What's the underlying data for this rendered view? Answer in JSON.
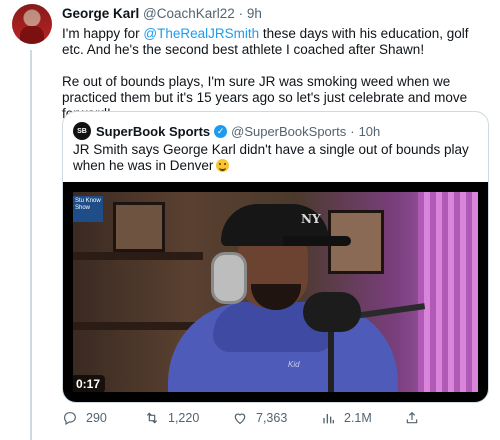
{
  "tweet": {
    "author_name": "George Karl",
    "handle": "@CoachKarl22",
    "separator": "·",
    "time": "9h",
    "text_line1_pre": "I'm happy for ",
    "mention": "@TheRealJRSmith",
    "text_line1_post": " these days with his education, golf etc. And he's the second best athlete I coached after Shawn!",
    "paragraph2": "Re out of bounds plays, I'm sure JR was smoking weed when we practiced them but it's 15 years ago so let's just celebrate and move forward!"
  },
  "quoted_tweet": {
    "avatar_label": "SB",
    "author_name": "SuperBook Sports",
    "verified_icon": "verified-badge-icon",
    "handle": "@SuperBookSports",
    "separator": "·",
    "time": "10h",
    "text": "JR Smith says George Karl didn't have a single out of bounds play when he was in Denver",
    "emoji": "grinning-face-emoji",
    "video": {
      "duration": "0:17",
      "cap_logo": "NY",
      "hoodie_mark": "Kid",
      "channel_badge": "Stu Know Show"
    }
  },
  "actions": {
    "reply_count": "290",
    "retweet_count": "1,220",
    "like_count": "7,363",
    "views_count": "2.1M",
    "icons": [
      "reply-icon",
      "retweet-icon",
      "like-icon",
      "views-icon",
      "share-icon"
    ]
  },
  "colors": {
    "link": "#1d9bf0",
    "secondary_text": "#536471",
    "border": "#cfd9de"
  }
}
